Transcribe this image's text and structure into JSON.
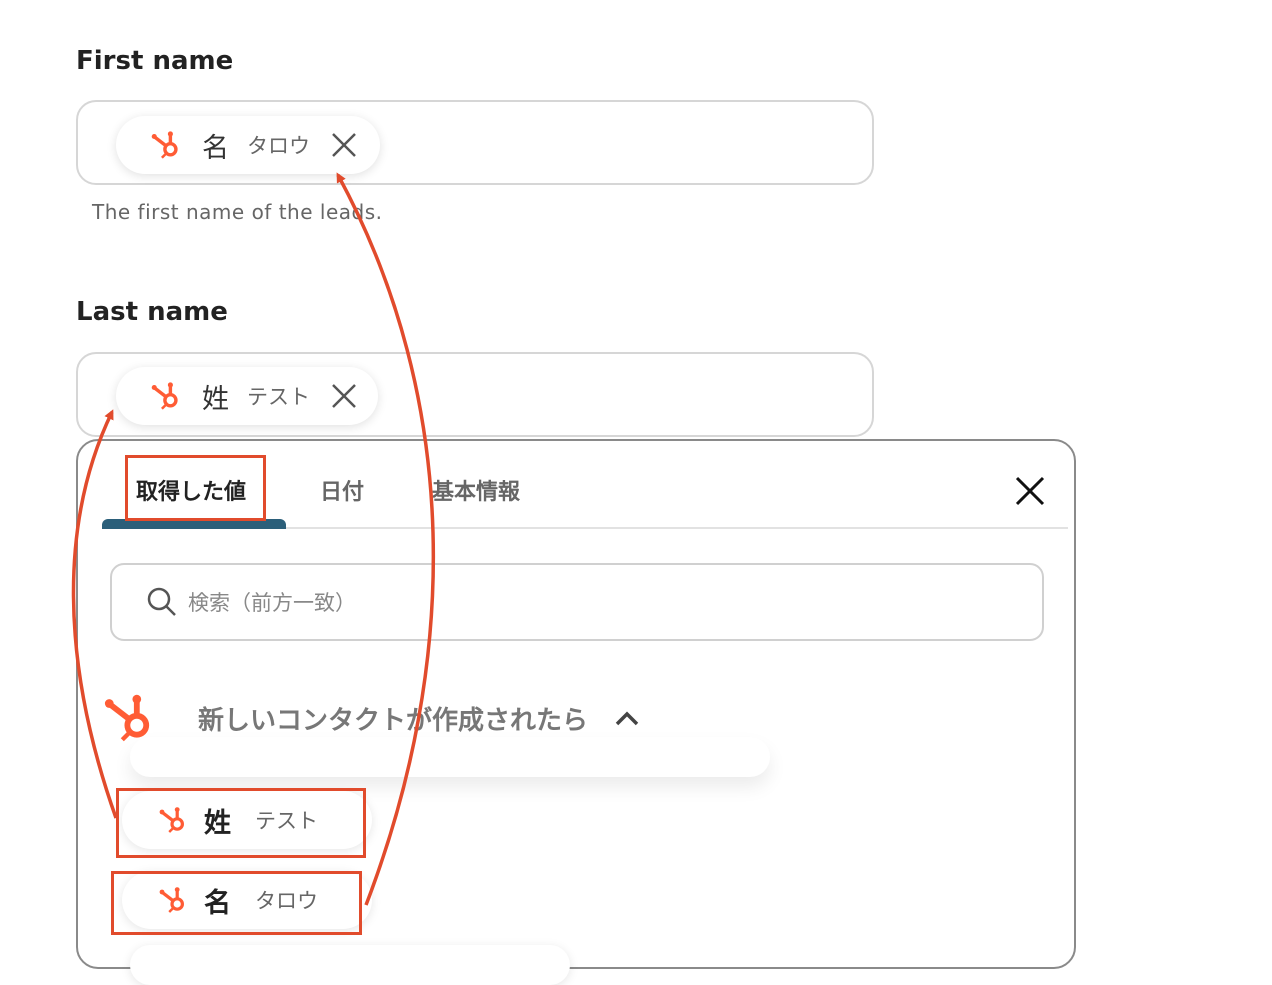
{
  "first_name": {
    "label": "First name",
    "chip": {
      "name": "名",
      "value": "タロウ"
    },
    "help": "The first name of the leads."
  },
  "last_name": {
    "label": "Last name",
    "chip": {
      "name": "姓",
      "value": "テスト"
    }
  },
  "panel": {
    "tabs": [
      {
        "label": "取得した値",
        "active": true
      },
      {
        "label": "日付",
        "active": false
      },
      {
        "label": "基本情報",
        "active": false
      }
    ],
    "search_placeholder": "検索（前方一致）",
    "group": {
      "title": "新しいコンタクトが作成されたら",
      "items": [
        {
          "name": "姓",
          "value": "テスト"
        },
        {
          "name": "名",
          "value": "タロウ"
        }
      ]
    }
  },
  "colors": {
    "hubspot_orange": "#ff5c35",
    "annotation_red": "#e14b2c",
    "tab_accent": "#2b5f7a"
  }
}
